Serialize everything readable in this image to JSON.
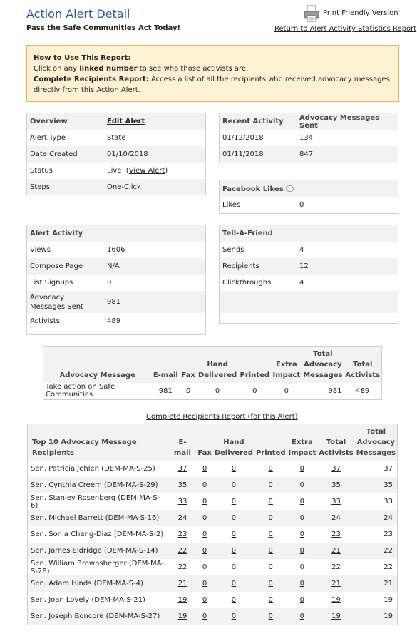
{
  "header": {
    "title": "Action Alert Detail",
    "subtitle": "Pass the Safe Communities Act Today!",
    "print_link": "Print Friendly Version",
    "return_link": "Return to Alert Activity Statistics Report",
    "print_icon": "printer-icon"
  },
  "howto": {
    "heading": "How to Use This Report:",
    "line1_pre": "Click on any ",
    "line1_bold": "linked number",
    "line1_post": " to see who those activists are.",
    "complete_label": "Complete Recipients Report:",
    "complete_text": " Access a list of all the recipients who received advocacy messages directly from this Action Alert."
  },
  "overview": {
    "heading": "Overview",
    "edit_link": "Edit Alert",
    "rows": [
      {
        "label": "Alert Type",
        "value": "State"
      },
      {
        "label": "Date Created",
        "value": "01/10/2018"
      },
      {
        "label": "Status",
        "value": "Live",
        "link": "View Alert"
      },
      {
        "label": "Steps",
        "value": "One-Click"
      }
    ]
  },
  "recent_activity": {
    "heading": "Recent Activity",
    "heading2": "Advocacy Messages Sent",
    "rows": [
      {
        "date": "01/12/2018",
        "count": "134"
      },
      {
        "date": "01/11/2018",
        "count": "847"
      }
    ]
  },
  "facebook": {
    "heading": "Facebook Likes",
    "icon": "speech-bubble-icon",
    "label": "Likes",
    "value": "0"
  },
  "alert_activity": {
    "heading": "Alert Activity",
    "rows": [
      {
        "label": "Views",
        "value": "1606"
      },
      {
        "label": "Compose Page",
        "value": "N/A"
      },
      {
        "label": "List Signups",
        "value": "0"
      },
      {
        "label": "Advocacy Messages Sent",
        "value": "981"
      },
      {
        "label": "Activists",
        "value": "489"
      }
    ]
  },
  "tell_a_friend": {
    "heading": "Tell-A-Friend",
    "rows": [
      {
        "label": "Sends",
        "value": "4"
      },
      {
        "label": "Recipients",
        "value": "12"
      },
      {
        "label": "Clickthroughs",
        "value": "4"
      }
    ]
  },
  "message_table": {
    "headers": [
      "Advocacy Message",
      "E-mail",
      "Fax",
      "Hand Delivered",
      "Printed",
      "Extra Impact",
      "Total Advocacy Messages",
      "Total Activists"
    ],
    "row": {
      "message": "Take action on Safe Communities",
      "email": "981",
      "fax": "0",
      "hand": "0",
      "printed": "0",
      "extra": "0",
      "total_messages": "981",
      "total_activists": "489"
    }
  },
  "complete_link": "Complete Recipients Report (for this Alert)",
  "recipients": {
    "headers": [
      "Top 10 Advocacy Message Recipients",
      "E-mail",
      "Fax",
      "Hand Delivered",
      "Printed",
      "Extra Impact",
      "Total Activists",
      "Total Advocacy Messages"
    ],
    "rows": [
      {
        "name": "Sen. Patricia Jehlen (DEM-MA-S-25)",
        "email": "37",
        "fax": "0",
        "hand": "0",
        "printed": "0",
        "extra": "0",
        "activists": "37",
        "messages": "37"
      },
      {
        "name": "Sen. Cynthia Creem (DEM-MA-S-29)",
        "email": "35",
        "fax": "0",
        "hand": "0",
        "printed": "0",
        "extra": "0",
        "activists": "35",
        "messages": "35"
      },
      {
        "name": "Sen. Stanley Rosenberg (DEM-MA-S-6)",
        "email": "33",
        "fax": "0",
        "hand": "0",
        "printed": "0",
        "extra": "0",
        "activists": "33",
        "messages": "33"
      },
      {
        "name": "Sen. Michael Barrett (DEM-MA-S-16)",
        "email": "24",
        "fax": "0",
        "hand": "0",
        "printed": "0",
        "extra": "0",
        "activists": "24",
        "messages": "24"
      },
      {
        "name": "Sen. Sonia Chang-Diaz (DEM-MA-S-2)",
        "email": "23",
        "fax": "0",
        "hand": "0",
        "printed": "0",
        "extra": "0",
        "activists": "23",
        "messages": "23"
      },
      {
        "name": "Sen. James Eldridge (DEM-MA-S-14)",
        "email": "22",
        "fax": "0",
        "hand": "0",
        "printed": "0",
        "extra": "0",
        "activists": "21",
        "messages": "22"
      },
      {
        "name": "Sen. William Brownsberger (DEM-MA-S-28)",
        "email": "22",
        "fax": "0",
        "hand": "0",
        "printed": "0",
        "extra": "0",
        "activists": "22",
        "messages": "22"
      },
      {
        "name": "Sen. Adam Hinds (DEM-MA-S-4)",
        "email": "21",
        "fax": "0",
        "hand": "0",
        "printed": "0",
        "extra": "0",
        "activists": "21",
        "messages": "21"
      },
      {
        "name": "Sen. Joan Lovely (DEM-MA-S-21)",
        "email": "19",
        "fax": "0",
        "hand": "0",
        "printed": "0",
        "extra": "0",
        "activists": "19",
        "messages": "19"
      },
      {
        "name": "Sen. Joseph Boncore (DEM-MA-S-27)",
        "email": "19",
        "fax": "0",
        "hand": "0",
        "printed": "0",
        "extra": "0",
        "activists": "19",
        "messages": "19"
      }
    ]
  }
}
